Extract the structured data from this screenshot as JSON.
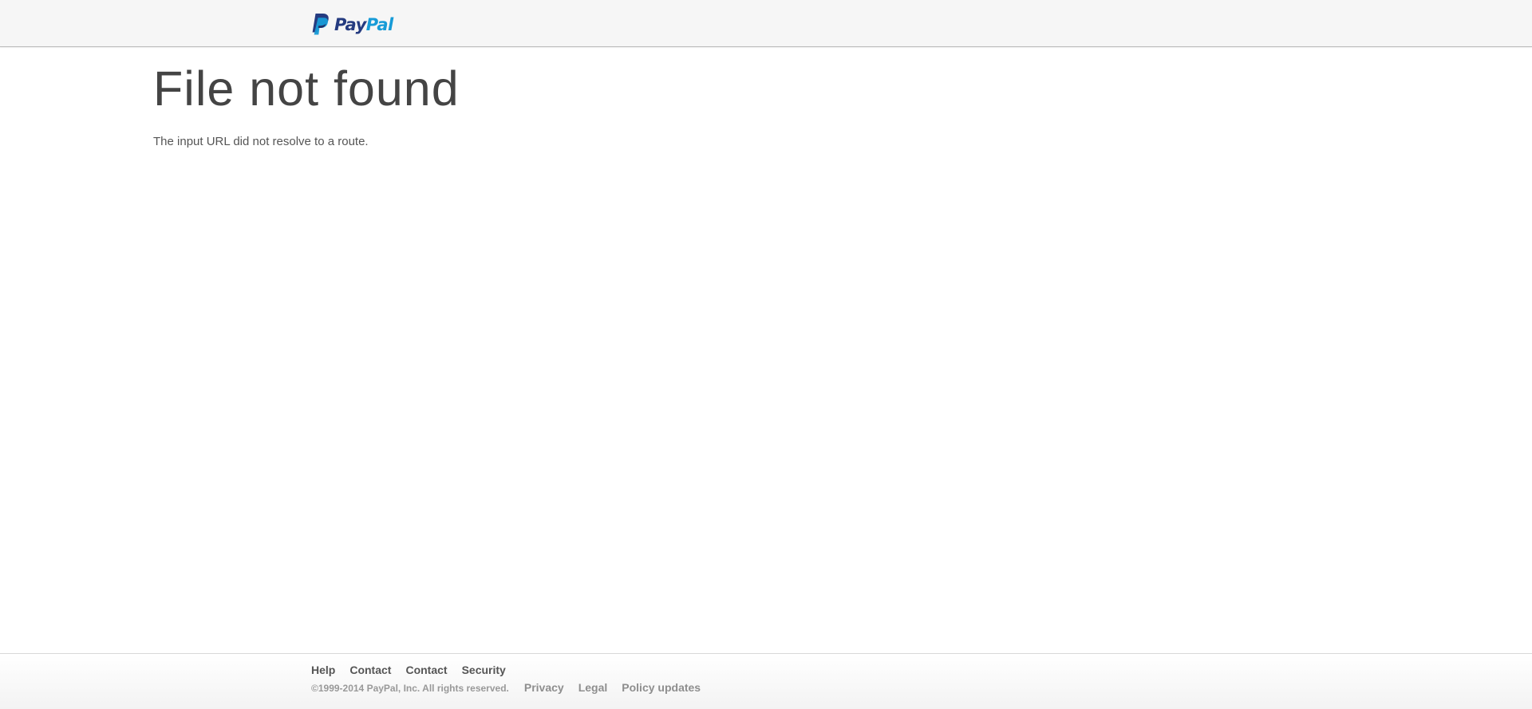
{
  "header": {
    "logo": {
      "word_pay": "Pay",
      "word_pal": "Pal",
      "icon": "paypal-logo-icon",
      "colors": {
        "dark_blue": "#253b80",
        "light_blue": "#179bd7",
        "mid_blue": "#222d65"
      }
    }
  },
  "main": {
    "title": "File not found",
    "message": "The input URL did not resolve to a route."
  },
  "footer": {
    "primary_links": [
      {
        "label": "Help"
      },
      {
        "label": "Contact"
      },
      {
        "label": "Contact"
      },
      {
        "label": "Security"
      }
    ],
    "copyright": "©1999-2014 PayPal, Inc. All rights reserved.",
    "secondary_links": [
      {
        "label": "Privacy"
      },
      {
        "label": "Legal"
      },
      {
        "label": "Policy updates"
      }
    ]
  }
}
